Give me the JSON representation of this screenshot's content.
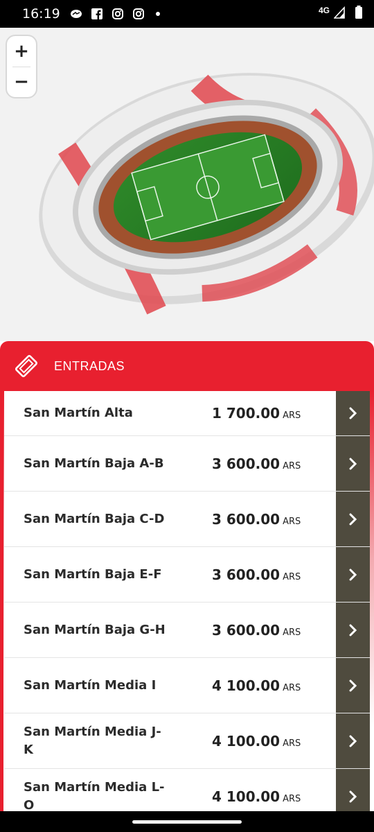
{
  "status_bar": {
    "time": "16:19",
    "network": "4G",
    "icons": [
      "messenger-icon",
      "facebook-icon",
      "instagram-icon",
      "instagram-icon",
      "dot-icon"
    ]
  },
  "map": {
    "zoom_in_label": "+",
    "zoom_out_label": "−"
  },
  "panel": {
    "title": "ENTRADAS",
    "accent_color": "#e8202f",
    "button_color": "#4f4b3e"
  },
  "tickets": [
    {
      "name": "San Martín Alta",
      "price": "1 700.00",
      "currency": "ARS"
    },
    {
      "name": "San Martín Baja A-B",
      "price": "3 600.00",
      "currency": "ARS"
    },
    {
      "name": "San Martín Baja C-D",
      "price": "3 600.00",
      "currency": "ARS"
    },
    {
      "name": "San Martín Baja E-F",
      "price": "3 600.00",
      "currency": "ARS"
    },
    {
      "name": "San Martín Baja G-H",
      "price": "3 600.00",
      "currency": "ARS"
    },
    {
      "name": "San Martín Media I",
      "price": "4 100.00",
      "currency": "ARS"
    },
    {
      "name": "San Martín Media J-K",
      "price": "4 100.00",
      "currency": "ARS"
    },
    {
      "name": "San Martín Media L-O",
      "price": "4 100.00",
      "currency": "ARS"
    }
  ]
}
